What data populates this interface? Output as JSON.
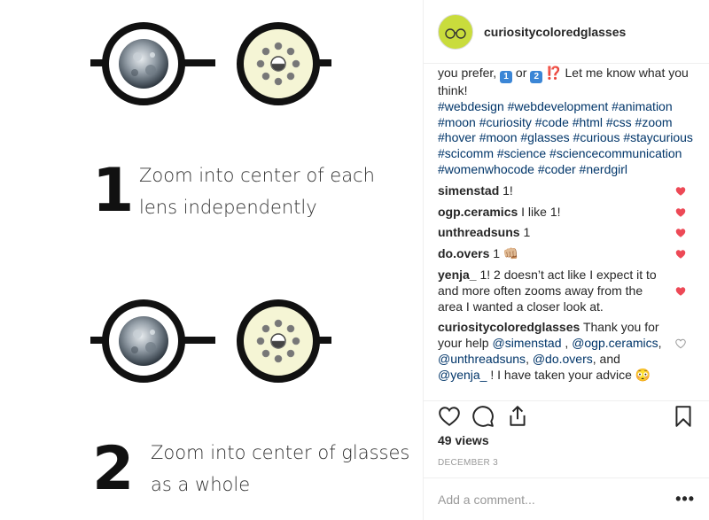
{
  "media": {
    "step1_number": "1",
    "step1_text": "Zoom into center of each lens independently",
    "step2_number": "2",
    "step2_text": "Zoom into center of glasses as a whole"
  },
  "post": {
    "username": "curiositycoloredglasses",
    "caption_text_a": "you prefer, ",
    "caption_opt1": "1",
    "caption_or": " or ",
    "caption_opt2": "2",
    "caption_exq": "⁉️",
    "caption_text_b": " Let me know what you think!",
    "hashtags": "#webdesign #webdevelopment #animation #moon #curiosity #code #html #css #zoom #hover #moon #glasses #curious #staycurious #scicomm #science #sciencecommunication #womenwhocode #coder #nerdgirl"
  },
  "comments": [
    {
      "user": "simenstad",
      "text": "1!",
      "liked": true
    },
    {
      "user": "ogp.ceramics",
      "text": "I like 1!",
      "liked": true
    },
    {
      "user": "unthreadsuns",
      "text": "1",
      "liked": true
    },
    {
      "user": "do.overs",
      "text": "1 👊🏼",
      "liked": true
    },
    {
      "user": "yenja_",
      "text": "1! 2 doesn’t act like I expect it to and more often zooms away from the area I wanted a closer look at.",
      "liked": true
    }
  ],
  "reply": {
    "user": "curiositycoloredglasses",
    "text_a": "Thank you for your help ",
    "m1": "@simenstad",
    "sep1": " , ",
    "m2": "@ogp.ceramics",
    "sep2": ", ",
    "m3": "@unthreadsuns",
    "sep3": ", ",
    "m4": "@do.overs",
    "sep4": ", and ",
    "m5": "@yenja_",
    "text_b": " ! I have taken your advice 😳",
    "liked": false
  },
  "views": "49 views",
  "date": "DECEMBER 3",
  "add_comment_placeholder": "Add a comment...",
  "more_label": "•••",
  "colors": {
    "heart_red": "#ed4956",
    "link_blue": "#003569",
    "lens_yellow": "#f5f5d5",
    "avatar_green": "#c9dc3c"
  },
  "icons": [
    "heart-icon",
    "comment-icon",
    "share-icon",
    "bookmark-icon",
    "moon-icon",
    "moon-phases-icon"
  ]
}
